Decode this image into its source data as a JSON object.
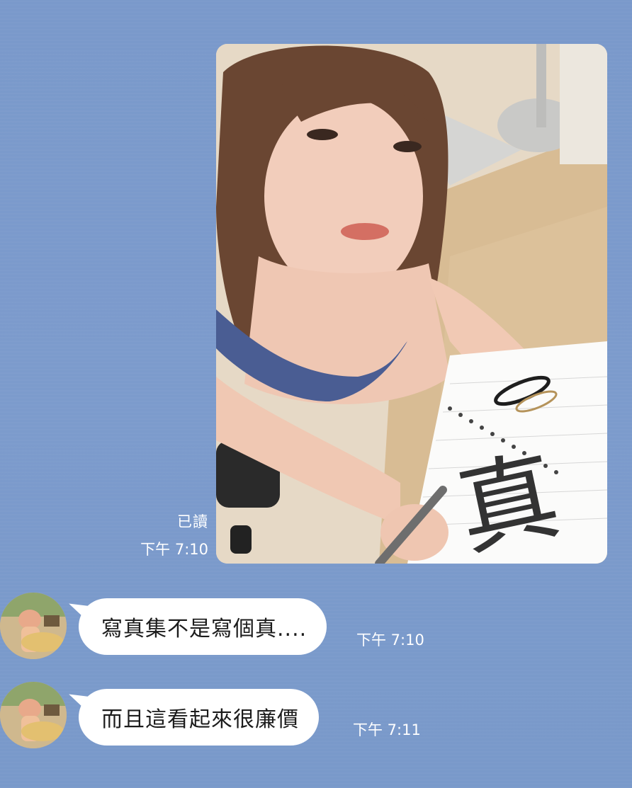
{
  "sent_message": {
    "read_status": "已讀",
    "time": "下午 7:10",
    "handwritten_glyph": "真"
  },
  "received_messages": [
    {
      "text": "寫真集不是寫個真....",
      "time": "下午 7:10"
    },
    {
      "text": "而且這看起來很廉價",
      "time": "下午 7:11"
    }
  ],
  "colors": {
    "chat_background": "#7b9acb",
    "bubble": "#ffffff",
    "meta_text": "#ffffff",
    "message_text": "#1c1c1c"
  }
}
